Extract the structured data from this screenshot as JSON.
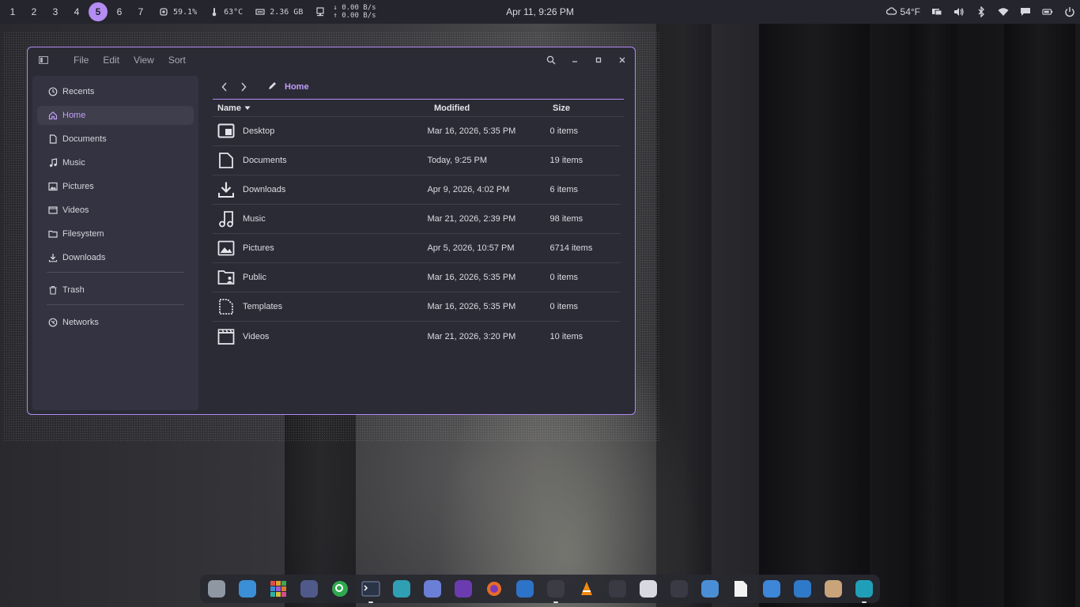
{
  "topbar": {
    "workspaces": [
      "1",
      "2",
      "3",
      "4",
      "5",
      "6",
      "7"
    ],
    "active_workspace": "5",
    "cpu": "59.1%",
    "temp": "63°C",
    "memory": "2.36 GB",
    "net_down": "↓ 0.00 B/s",
    "net_up": "↑ 0.00 B/s",
    "clock": "Apr 11, 9:26 PM",
    "weather": "54°F"
  },
  "window": {
    "menu": [
      "File",
      "Edit",
      "View",
      "Sort"
    ],
    "sidebar": {
      "items": [
        {
          "label": "Recents",
          "icon": "clock-icon"
        },
        {
          "label": "Home",
          "icon": "home-icon",
          "active": true
        },
        {
          "label": "Documents",
          "icon": "document-icon"
        },
        {
          "label": "Music",
          "icon": "music-icon"
        },
        {
          "label": "Pictures",
          "icon": "picture-icon"
        },
        {
          "label": "Videos",
          "icon": "video-icon"
        },
        {
          "label": "Filesystem",
          "icon": "folder-icon"
        },
        {
          "label": "Downloads",
          "icon": "download-icon"
        }
      ],
      "trash": "Trash",
      "networks": "Networks"
    },
    "breadcrumb": "Home",
    "columns": {
      "name": "Name",
      "modified": "Modified",
      "size": "Size"
    },
    "files": [
      {
        "name": "Desktop",
        "modified": "Mar 16, 2026, 5:35 PM",
        "size": "0 items",
        "icon": "desktop-folder-icon"
      },
      {
        "name": "Documents",
        "modified": "Today, 9:25 PM",
        "size": "19 items",
        "icon": "document-folder-icon"
      },
      {
        "name": "Downloads",
        "modified": "Apr 9, 2026, 4:02 PM",
        "size": "6 items",
        "icon": "download-folder-icon"
      },
      {
        "name": "Music",
        "modified": "Mar 21, 2026, 2:39 PM",
        "size": "98 items",
        "icon": "music-folder-icon"
      },
      {
        "name": "Pictures",
        "modified": "Apr 5, 2026, 10:57 PM",
        "size": "6714 items",
        "icon": "picture-folder-icon"
      },
      {
        "name": "Public",
        "modified": "Mar 16, 2026, 5:35 PM",
        "size": "0 items",
        "icon": "public-folder-icon"
      },
      {
        "name": "Templates",
        "modified": "Mar 16, 2026, 5:35 PM",
        "size": "0 items",
        "icon": "template-folder-icon"
      },
      {
        "name": "Videos",
        "modified": "Mar 21, 2026, 3:20 PM",
        "size": "10 items",
        "icon": "video-folder-icon"
      }
    ]
  },
  "dock": {
    "apps": [
      {
        "name": "launcher-app",
        "color": "#8f97a3"
      },
      {
        "name": "files-app",
        "color": "#3b8fd6"
      },
      {
        "name": "app-grid",
        "color": "#e0a32b"
      },
      {
        "name": "system-monitor-app",
        "color": "#4f5a8a"
      },
      {
        "name": "search-app",
        "color": "#2fa84f"
      },
      {
        "name": "terminal-app",
        "color": "#2b3446"
      },
      {
        "name": "camera-app",
        "color": "#2f9fb3"
      },
      {
        "name": "software-store-app",
        "color": "#6b7fd6"
      },
      {
        "name": "vpn-app",
        "color": "#6b3bb0"
      },
      {
        "name": "firefox-app",
        "color": "#e86b28"
      },
      {
        "name": "thunderbird-app",
        "color": "#2d73c7"
      },
      {
        "name": "media-player-app",
        "color": "#3c3c44"
      },
      {
        "name": "vlc-app",
        "color": "#f08a12"
      },
      {
        "name": "inkscape-app",
        "color": "#3a3a44"
      },
      {
        "name": "color-picker-app",
        "color": "#d8d8e0"
      },
      {
        "name": "sublime-app",
        "color": "#3a3a44"
      },
      {
        "name": "text-editor-app",
        "color": "#4a8fd6"
      },
      {
        "name": "document-app",
        "color": "#f2f2f2"
      },
      {
        "name": "image-viewer-app",
        "color": "#3d86d8"
      },
      {
        "name": "screenshot-app",
        "color": "#2f79c9"
      },
      {
        "name": "calculator-app",
        "color": "#c9a37a"
      },
      {
        "name": "file-manager-app",
        "color": "#1fa0b8"
      }
    ]
  }
}
